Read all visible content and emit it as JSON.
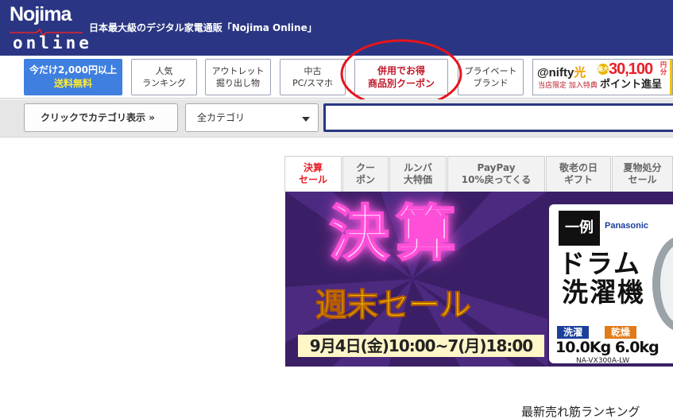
{
  "header": {
    "logo_top": "Nojima",
    "logo_bottom": "online",
    "tagline": "日本最大級のデジタル家電通販「Nojima Online」"
  },
  "nav": {
    "free_shipping_line1": "今だけ2,000円以上",
    "free_shipping_line2": "送料無料",
    "items": [
      {
        "line1": "人気",
        "line2": "ランキング"
      },
      {
        "line1": "アウトレット",
        "line2": "掘り出し物"
      },
      {
        "line1": "中古",
        "line2": "PC/スマホ"
      },
      {
        "line1": "併用でお得",
        "line2": "商品別クーポン"
      },
      {
        "line1": "プライベート",
        "line2": "ブランド"
      }
    ],
    "nifty": {
      "name": "@nifty",
      "hikari": "光",
      "sub": "当店限定 加入特典",
      "badge": "最大",
      "amount": "30,100",
      "yen": "円分",
      "points": "ポイント進呈"
    }
  },
  "search": {
    "category_button": "クリックでカテゴリ表示 »",
    "category_select": "全カテゴリ",
    "input_value": ""
  },
  "tabs": [
    {
      "line1": "決算",
      "line2": "セール",
      "active": true
    },
    {
      "line1": "クー",
      "line2": "ポン",
      "active": false
    },
    {
      "line1": "ルンバ",
      "line2": "大特価",
      "active": false
    },
    {
      "line1": "PayPay",
      "line2": "10%戻ってくる",
      "active": false
    },
    {
      "line1": "敬老の日",
      "line2": "ギフト",
      "active": false
    },
    {
      "line1": "夏物処分",
      "line2": "セール",
      "active": false
    }
  ],
  "banner": {
    "title": "決算",
    "subtitle": "週末セール",
    "date": "9月4日(金)10:00~7(月)18:00",
    "example": "一例",
    "brand": "Panasonic",
    "product_line1": "ドラム",
    "product_line2": "洗濯機",
    "label_wash": "洗濯",
    "label_dry": "乾燥",
    "capacity": "10.0Kg 6.0kg",
    "model": "NA-VX300A-LW"
  },
  "ranking_heading": "最新売れ筋ランキング"
}
